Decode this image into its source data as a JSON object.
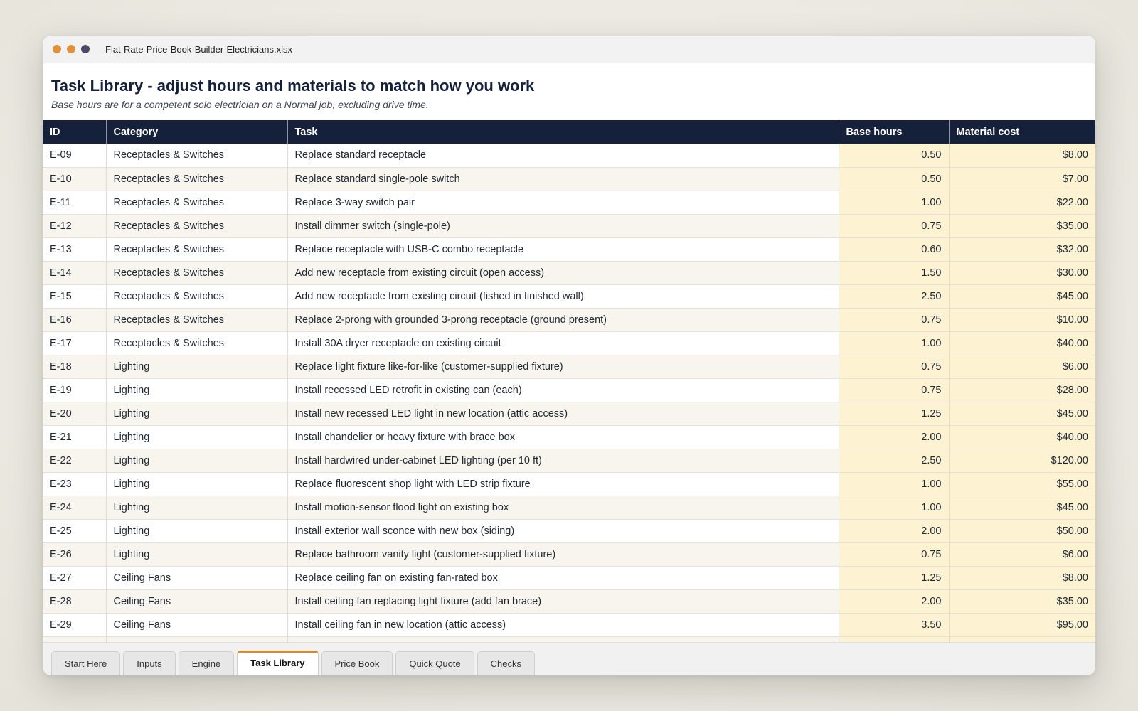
{
  "window": {
    "title": "Flat-Rate-Price-Book-Builder-Electricians.xlsx",
    "controls": [
      {
        "name": "close",
        "color": "#e0913a"
      },
      {
        "name": "minimize",
        "color": "#e0913a"
      },
      {
        "name": "maximize",
        "color": "#4c4a66"
      }
    ]
  },
  "header": {
    "title": "Task Library - adjust hours and materials to match how you work",
    "subtitle": "Base hours are for a competent solo electrician on a Normal job, excluding drive time."
  },
  "table": {
    "columns": [
      "ID",
      "Category",
      "Task",
      "Base hours",
      "Material cost"
    ],
    "rows": [
      {
        "id": "E-09",
        "category": "Receptacles & Switches",
        "task": "Replace standard receptacle",
        "hours": "0.50",
        "cost": "$8.00"
      },
      {
        "id": "E-10",
        "category": "Receptacles & Switches",
        "task": "Replace standard single-pole switch",
        "hours": "0.50",
        "cost": "$7.00"
      },
      {
        "id": "E-11",
        "category": "Receptacles & Switches",
        "task": "Replace 3-way switch pair",
        "hours": "1.00",
        "cost": "$22.00"
      },
      {
        "id": "E-12",
        "category": "Receptacles & Switches",
        "task": "Install dimmer switch (single-pole)",
        "hours": "0.75",
        "cost": "$35.00"
      },
      {
        "id": "E-13",
        "category": "Receptacles & Switches",
        "task": "Replace receptacle with USB-C combo receptacle",
        "hours": "0.60",
        "cost": "$32.00"
      },
      {
        "id": "E-14",
        "category": "Receptacles & Switches",
        "task": "Add new receptacle from existing circuit (open access)",
        "hours": "1.50",
        "cost": "$30.00"
      },
      {
        "id": "E-15",
        "category": "Receptacles & Switches",
        "task": "Add new receptacle from existing circuit (fished in finished wall)",
        "hours": "2.50",
        "cost": "$45.00"
      },
      {
        "id": "E-16",
        "category": "Receptacles & Switches",
        "task": "Replace 2-prong with grounded 3-prong receptacle (ground present)",
        "hours": "0.75",
        "cost": "$10.00"
      },
      {
        "id": "E-17",
        "category": "Receptacles & Switches",
        "task": "Install 30A dryer receptacle on existing circuit",
        "hours": "1.00",
        "cost": "$40.00"
      },
      {
        "id": "E-18",
        "category": "Lighting",
        "task": "Replace light fixture like-for-like (customer-supplied fixture)",
        "hours": "0.75",
        "cost": "$6.00"
      },
      {
        "id": "E-19",
        "category": "Lighting",
        "task": "Install recessed LED retrofit in existing can (each)",
        "hours": "0.75",
        "cost": "$28.00"
      },
      {
        "id": "E-20",
        "category": "Lighting",
        "task": "Install new recessed LED light in new location (attic access)",
        "hours": "1.25",
        "cost": "$45.00"
      },
      {
        "id": "E-21",
        "category": "Lighting",
        "task": "Install chandelier or heavy fixture with brace box",
        "hours": "2.00",
        "cost": "$40.00"
      },
      {
        "id": "E-22",
        "category": "Lighting",
        "task": "Install hardwired under-cabinet LED lighting (per 10 ft)",
        "hours": "2.50",
        "cost": "$120.00"
      },
      {
        "id": "E-23",
        "category": "Lighting",
        "task": "Replace fluorescent shop light with LED strip fixture",
        "hours": "1.00",
        "cost": "$55.00"
      },
      {
        "id": "E-24",
        "category": "Lighting",
        "task": "Install motion-sensor flood light on existing box",
        "hours": "1.00",
        "cost": "$45.00"
      },
      {
        "id": "E-25",
        "category": "Lighting",
        "task": "Install exterior wall sconce with new box (siding)",
        "hours": "2.00",
        "cost": "$50.00"
      },
      {
        "id": "E-26",
        "category": "Lighting",
        "task": "Replace bathroom vanity light (customer-supplied fixture)",
        "hours": "0.75",
        "cost": "$6.00"
      },
      {
        "id": "E-27",
        "category": "Ceiling Fans",
        "task": "Replace ceiling fan on existing fan-rated box",
        "hours": "1.25",
        "cost": "$8.00"
      },
      {
        "id": "E-28",
        "category": "Ceiling Fans",
        "task": "Install ceiling fan replacing light fixture (add fan brace)",
        "hours": "2.00",
        "cost": "$35.00"
      },
      {
        "id": "E-29",
        "category": "Ceiling Fans",
        "task": "Install ceiling fan in new location (attic access)",
        "hours": "3.50",
        "cost": "$95.00"
      },
      {
        "id": "",
        "category": "",
        "task": "",
        "hours": "",
        "cost": ""
      }
    ]
  },
  "tabs": [
    {
      "label": "Start Here",
      "active": false
    },
    {
      "label": "Inputs",
      "active": false
    },
    {
      "label": "Engine",
      "active": false
    },
    {
      "label": "Task Library",
      "active": true
    },
    {
      "label": "Price Book",
      "active": false
    },
    {
      "label": "Quick Quote",
      "active": false
    },
    {
      "label": "Checks",
      "active": false
    }
  ],
  "colors": {
    "header_bg": "#15203a",
    "input_cell_bg": "#fdf3d3",
    "active_tab_accent": "#d98a2b",
    "zebra_bg": "#f8f5ee"
  }
}
